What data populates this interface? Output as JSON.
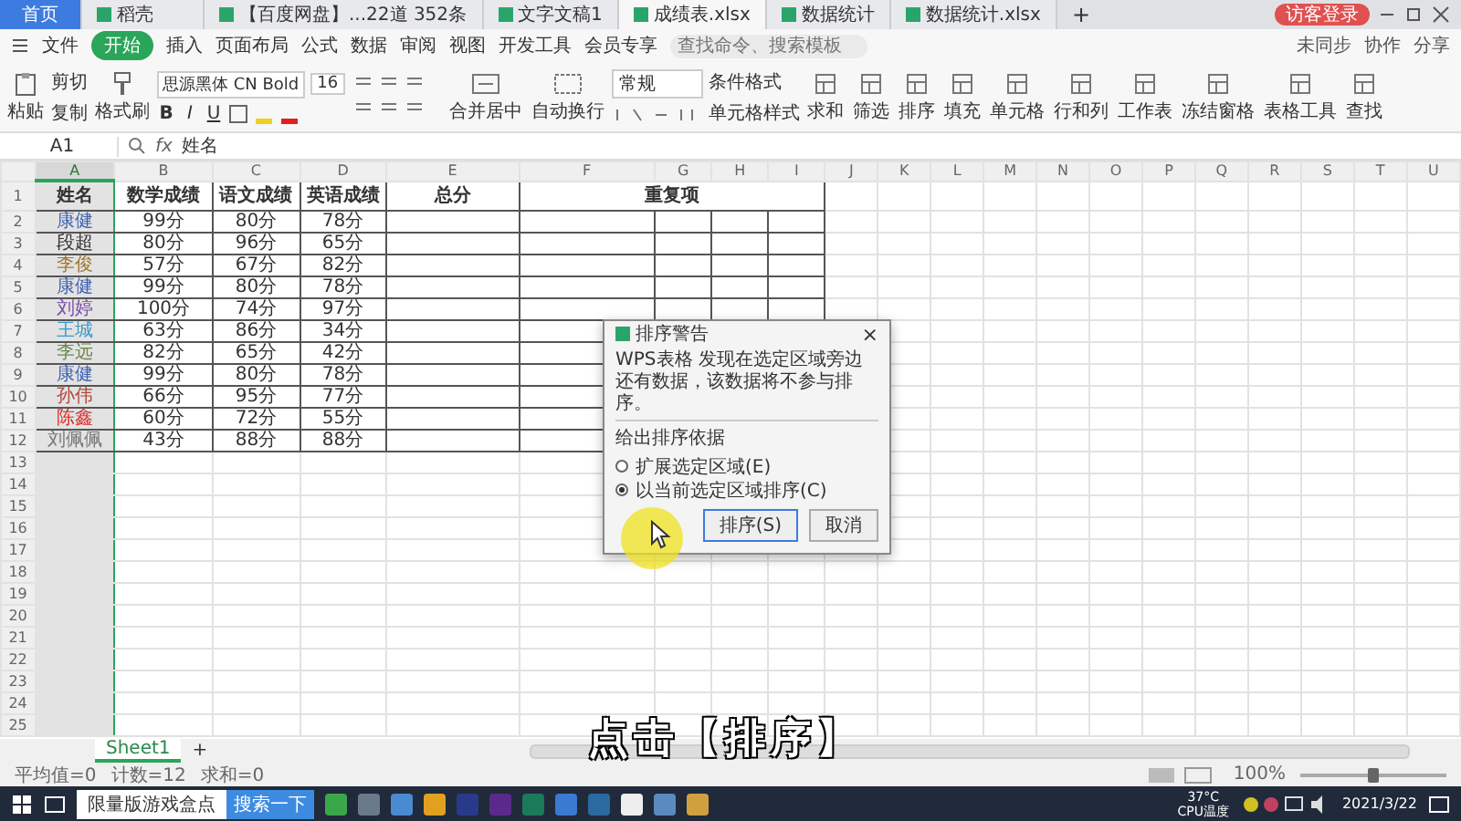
{
  "tabs": [
    {
      "label": "首页",
      "kind": "home",
      "selected": false
    },
    {
      "label": "稻壳",
      "kind": "doc",
      "selected": false
    },
    {
      "label": "【百度网盘】...22道 352条",
      "kind": "doc",
      "selected": false
    },
    {
      "label": "文字文稿1",
      "kind": "doc",
      "selected": false
    },
    {
      "label": "成绩表.xlsx",
      "kind": "doc",
      "selected": true
    },
    {
      "label": "数据统计",
      "kind": "doc",
      "selected": false
    },
    {
      "label": "数据统计.xlsx",
      "kind": "doc",
      "selected": false
    }
  ],
  "new_tab": "+",
  "login": "访客登录",
  "menu": {
    "file": "文件",
    "items": [
      {
        "label": "开始",
        "selected": true
      },
      {
        "label": "插入",
        "selected": false
      },
      {
        "label": "页面布局",
        "selected": false
      },
      {
        "label": "公式",
        "selected": false
      },
      {
        "label": "数据",
        "selected": false
      },
      {
        "label": "审阅",
        "selected": false
      },
      {
        "label": "视图",
        "selected": false
      },
      {
        "label": "开发工具",
        "selected": false
      },
      {
        "label": "会员专享",
        "selected": false
      }
    ],
    "search": {
      "placeholder": "查找命令、搜索模板"
    },
    "right": [
      "未同步",
      "协作",
      "分享"
    ]
  },
  "ribbon": {
    "paste": "粘贴",
    "cut": "剪切",
    "copy": "复制",
    "format_painter": "格式刷",
    "font": "思源黑体 CN Bold",
    "size": "16",
    "bold": "B",
    "italic": "I",
    "underline": "U",
    "merge": "合并居中",
    "wrap": "自动换行",
    "number_format": "常规",
    "conditional": "条件格式",
    "cell_style": "单元格样式",
    "tools": [
      "求和",
      "筛选",
      "排序",
      "填充",
      "单元格",
      "行和列",
      "工作表",
      "冻结窗格",
      "表格工具",
      "查找"
    ]
  },
  "name_box": "A1",
  "fx": "fx",
  "formula": "姓名",
  "columns": [
    {
      "label": "A",
      "selected": true
    },
    {
      "label": "B",
      "selected": false
    },
    {
      "label": "C",
      "selected": false
    },
    {
      "label": "D",
      "selected": false
    },
    {
      "label": "E",
      "selected": false
    },
    {
      "label": "F",
      "selected": false
    },
    {
      "label": "G",
      "selected": false
    },
    {
      "label": "H",
      "selected": false
    },
    {
      "label": "I",
      "selected": false
    },
    {
      "label": "J",
      "selected": false
    },
    {
      "label": "K",
      "selected": false
    },
    {
      "label": "L",
      "selected": false
    },
    {
      "label": "M",
      "selected": false
    },
    {
      "label": "N",
      "selected": false
    },
    {
      "label": "O",
      "selected": false
    },
    {
      "label": "P",
      "selected": false
    },
    {
      "label": "Q",
      "selected": false
    },
    {
      "label": "R",
      "selected": false
    },
    {
      "label": "S",
      "selected": false
    },
    {
      "label": "T",
      "selected": false
    },
    {
      "label": "U",
      "selected": false
    }
  ],
  "header_row": {
    "num": "1",
    "headers": [
      "姓名",
      "数学成绩",
      "语文成绩",
      "英语成绩",
      "总分",
      "重复项"
    ]
  },
  "rows": [
    {
      "num": "2",
      "name": "康健",
      "color": "#3f62b0",
      "math": "99分",
      "chinese": "80分",
      "english": "78分"
    },
    {
      "num": "3",
      "name": "段超",
      "color": "#333333",
      "math": "80分",
      "chinese": "96分",
      "english": "65分"
    },
    {
      "num": "4",
      "name": "李俊",
      "color": "#a0782c",
      "math": "57分",
      "chinese": "67分",
      "english": "82分"
    },
    {
      "num": "5",
      "name": "康健",
      "color": "#3f62b0",
      "math": "99分",
      "chinese": "80分",
      "english": "78分"
    },
    {
      "num": "6",
      "name": "刘婷",
      "color": "#7a4aa8",
      "math": "100分",
      "chinese": "74分",
      "english": "97分"
    },
    {
      "num": "7",
      "name": "王城",
      "color": "#3a9ad0",
      "math": "63分",
      "chinese": "86分",
      "english": "34分"
    },
    {
      "num": "8",
      "name": "李远",
      "color": "#6a8a4a",
      "math": "82分",
      "chinese": "65分",
      "english": "42分"
    },
    {
      "num": "9",
      "name": "康健",
      "color": "#3f62b0",
      "math": "99分",
      "chinese": "80分",
      "english": "78分"
    },
    {
      "num": "10",
      "name": "孙伟",
      "color": "#b0483a",
      "math": "66分",
      "chinese": "95分",
      "english": "77分"
    },
    {
      "num": "11",
      "name": "陈鑫",
      "color": "#e02828",
      "math": "60分",
      "chinese": "72分",
      "english": "55分"
    },
    {
      "num": "12",
      "name": "刘佩佩",
      "color": "#777777",
      "math": "43分",
      "chinese": "88分",
      "english": "88分"
    }
  ],
  "empty_rows": [
    "13",
    "14",
    "15",
    "16",
    "17",
    "18",
    "19",
    "20",
    "21",
    "22",
    "23",
    "24",
    "25"
  ],
  "dialog": {
    "title": "排序警告",
    "close": "×",
    "message": "WPS表格 发现在选定区域旁边还有数据，该数据将不参与排序。",
    "section": "给出排序依据",
    "options": [
      {
        "label": "扩展选定区域(E)",
        "selected": false
      },
      {
        "label": "以当前选定区域排序(C)",
        "selected": true
      }
    ],
    "buttons": [
      {
        "label": "排序(S)",
        "default": true
      },
      {
        "label": "取消",
        "default": false
      }
    ]
  },
  "caption": "点击【排序】",
  "sheets": [
    {
      "label": "Sheet1",
      "selected": true
    }
  ],
  "add_sheet": "+",
  "status": {
    "stats": [
      "平均值=0",
      "计数=12",
      "求和=0"
    ],
    "zoom": "100%",
    "zoom_slider": {
      "level": 0.5
    }
  },
  "taskbar": {
    "search": "限量版游戏盒点",
    "search_button": "搜索一下",
    "temperature": "37°C",
    "temperature_label": "CPU温度",
    "date": "2021/3/22"
  }
}
